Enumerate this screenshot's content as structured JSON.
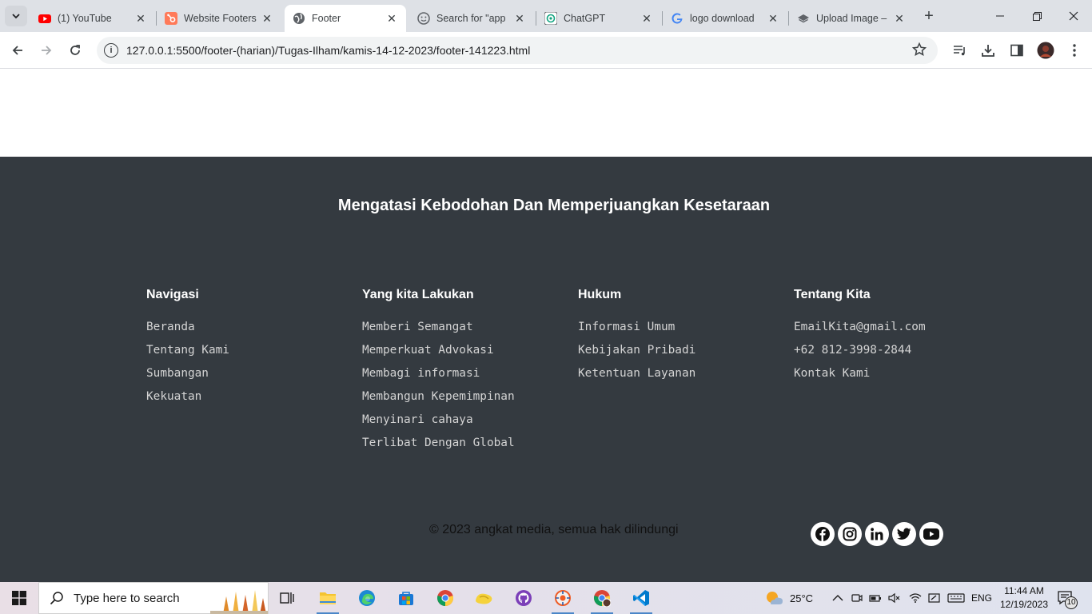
{
  "browser": {
    "tabs": [
      {
        "title": "(1) YouTube",
        "favicon": "youtube-icon",
        "active": false
      },
      {
        "title": "Website Footers",
        "favicon": "hubspot-icon",
        "active": false
      },
      {
        "title": "Footer",
        "favicon": "globe-icon",
        "active": true
      },
      {
        "title": "Search for \"app",
        "favicon": "emoji-search-icon",
        "active": false
      },
      {
        "title": "ChatGPT",
        "favicon": "chatgpt-icon",
        "active": false
      },
      {
        "title": "logo download",
        "favicon": "google-icon",
        "active": false
      },
      {
        "title": "Upload Image –",
        "favicon": "layers-icon",
        "active": false
      }
    ],
    "url": "127.0.0.1:5500/footer-(harian)/Tugas-Ilham/kamis-14-12-2023/footer-141223.html"
  },
  "footer": {
    "heading": "Mengatasi Kebodohan Dan Memperjuangkan Kesetaraan",
    "columns": [
      {
        "title": "Navigasi",
        "items": [
          "Beranda",
          "Tentang Kami",
          "Sumbangan",
          "Kekuatan"
        ]
      },
      {
        "title": "Yang kita Lakukan",
        "items": [
          "Memberi Semangat",
          "Memperkuat Advokasi",
          "Membagi informasi",
          "Membangun Kepemimpinan",
          "Menyinari cahaya",
          "Terlibat Dengan Global"
        ]
      },
      {
        "title": "Hukum",
        "items": [
          "Informasi Umum",
          "Kebijakan Pribadi",
          "Ketentuan Layanan"
        ]
      },
      {
        "title": "Tentang Kita",
        "items": [
          "EmailKita@gmail.com",
          "+62 812-3998-2844",
          "Kontak Kami"
        ]
      }
    ],
    "copyright": "© 2023 angkat media, semua hak dilindungi",
    "social": [
      "facebook-icon",
      "instagram-icon",
      "linkedin-icon",
      "twitter-icon",
      "youtube-icon"
    ]
  },
  "taskbar": {
    "search_placeholder": "Type here to search",
    "weather": "25°C",
    "language": "ENG",
    "time": "11:44 AM",
    "date": "12/19/2023",
    "notifications": "10"
  },
  "colors": {
    "footer_bg": "#343a40",
    "link_text": "#d4d4d4",
    "tabstrip_bg": "#dee1e6"
  }
}
